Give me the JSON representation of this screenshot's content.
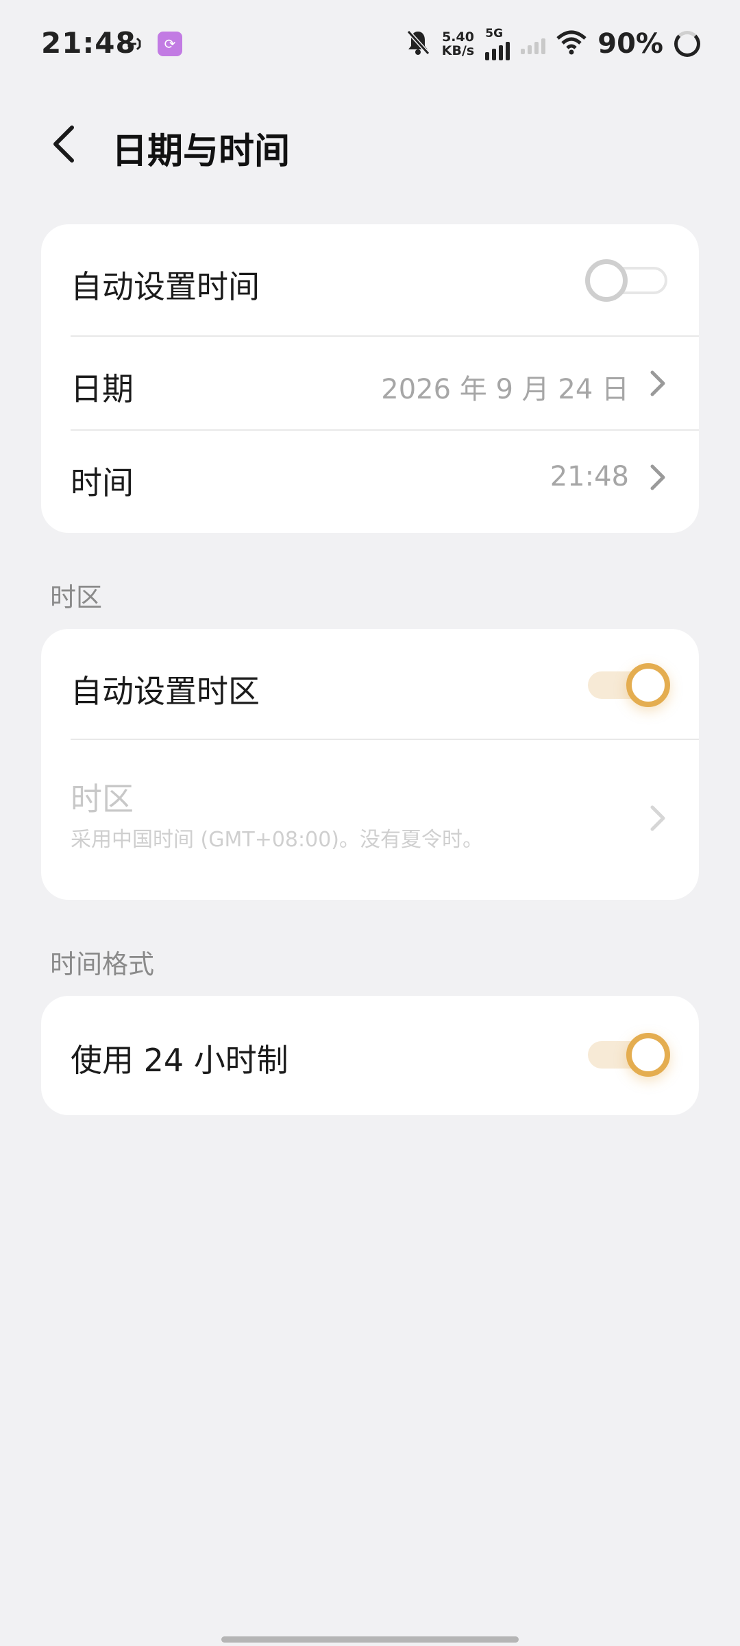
{
  "status_bar": {
    "time": "21:48",
    "net_speed_value": "5.40",
    "net_speed_unit": "KB/s",
    "network_type": "5G",
    "battery": "90%",
    "icons": [
      "nfc-icon",
      "app-badge-icon",
      "mute-bell-icon",
      "signal-icon",
      "wifi-icon",
      "battery-ring-icon"
    ]
  },
  "header": {
    "title": "日期与时间"
  },
  "card_datetime": {
    "auto_time_label": "自动设置时间",
    "auto_time_on": false,
    "date_label": "日期",
    "date_value": "2026 年 9 月 24 日",
    "time_label": "时间",
    "time_value": "21:48"
  },
  "section_timezone": {
    "label": "时区",
    "auto_zone_label": "自动设置时区",
    "auto_zone_on": true,
    "zone_label": "时区",
    "zone_desc": "采用中国时间 (GMT+08:00)。没有夏令时。"
  },
  "section_format": {
    "label": "时间格式",
    "use24_label": "使用 24 小时制",
    "use24_on": true
  },
  "colors": {
    "accent": "#e4ad50",
    "accent_track": "#f7ead6",
    "background": "#f1f1f3",
    "card": "#ffffff"
  }
}
